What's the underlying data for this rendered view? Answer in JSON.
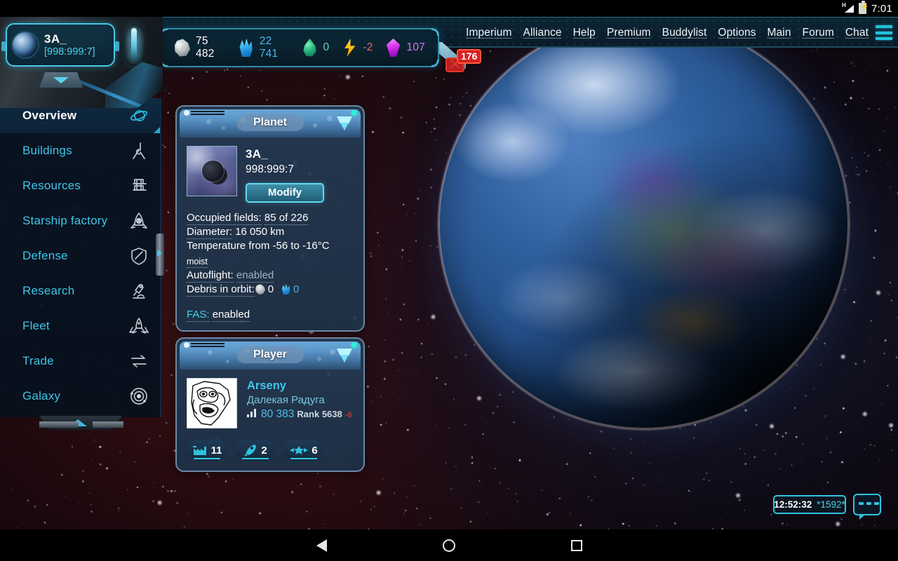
{
  "status_bar": {
    "signal_label": "H",
    "battery_icon": "battery-charging-icon",
    "clock": "7:01"
  },
  "top_nav": {
    "items": [
      {
        "label": "Imperium",
        "name": "imperium"
      },
      {
        "label": "Alliance",
        "name": "alliance"
      },
      {
        "label": "Help",
        "name": "help"
      },
      {
        "label": "Premium",
        "name": "premium"
      },
      {
        "label": "Buddylist",
        "name": "buddylist"
      },
      {
        "label": "Options",
        "name": "options"
      },
      {
        "label": "Main",
        "name": "main"
      },
      {
        "label": "Forum",
        "name": "forum"
      },
      {
        "label": "Chat",
        "name": "chat"
      }
    ],
    "menu_icon": "hamburger-menu-icon"
  },
  "planet_selector": {
    "name": "3A_",
    "coords": "[998:999:7]",
    "dropdown_icon": "chevron-down-icon"
  },
  "resources": [
    {
      "key": "metal",
      "icon": "metal-rock-icon",
      "value": "75 482",
      "color": "#ffffff"
    },
    {
      "key": "crystal",
      "icon": "crystal-icon",
      "value": "22 741",
      "color": "#4cb8ec"
    },
    {
      "key": "deuterium",
      "icon": "deuterium-icon",
      "value": "0",
      "color": "#63d9a6"
    },
    {
      "key": "energy",
      "icon": "energy-bolt-icon",
      "value": "-2",
      "color": "#e86a6a"
    },
    {
      "key": "darkmatter",
      "icon": "dark-matter-icon",
      "value": "107",
      "color": "#d678f0"
    }
  ],
  "mail": {
    "icon": "mail-envelope-icon",
    "unread_count": "176"
  },
  "sidebar": {
    "items": [
      {
        "label": "Overview",
        "icon": "planet-ring-icon",
        "name": "overview",
        "active": true
      },
      {
        "label": "Buildings",
        "icon": "crane-hook-icon",
        "name": "buildings",
        "active": false
      },
      {
        "label": "Resources",
        "icon": "resource-racks-icon",
        "name": "resources",
        "active": false
      },
      {
        "label": "Starship factory",
        "icon": "rocket-gear-icon",
        "name": "starship-factory",
        "active": false
      },
      {
        "label": "Defense",
        "icon": "shield-icon",
        "name": "defense",
        "active": false
      },
      {
        "label": "Research",
        "icon": "microscope-icon",
        "name": "research",
        "active": false
      },
      {
        "label": "Fleet",
        "icon": "fleet-ships-icon",
        "name": "fleet",
        "active": false
      },
      {
        "label": "Trade",
        "icon": "exchange-arrows-icon",
        "name": "trade",
        "active": false
      },
      {
        "label": "Galaxy",
        "icon": "galaxy-orbit-icon",
        "name": "galaxy",
        "active": false
      }
    ],
    "collapse_icon": "chevron-up-icon"
  },
  "planet_panel": {
    "title": "Planet",
    "collapse_icon": "chevron-down-icon",
    "thumbnail_icon": "planet-thumbnail",
    "name": "3A_",
    "coords": "998:999:7",
    "modify_label": "Modify",
    "fields_label": "Occupied fields:",
    "fields_value": "85 of 226",
    "diameter_label": "Diameter:",
    "diameter_value": "16 050 km",
    "temperature_label": "Temperature from",
    "temperature_value": "-56 to -16°C",
    "climate": "moist",
    "autoflight_label": "Autoflight:",
    "autoflight_value": "enabled",
    "debris_label": "Debris in orbit:",
    "debris_metal": "0",
    "debris_crystal": "0",
    "fas_label": "FAS:",
    "fas_value": "enabled"
  },
  "player_panel": {
    "title": "Player",
    "collapse_icon": "chevron-down-icon",
    "avatar_icon": "troll-face-avatar",
    "name": "Arseny",
    "alliance": "Далекая Радуга",
    "points_icon": "bar-chart-icon",
    "points": "80 383",
    "rank_label": "Rank 5638",
    "rank_delta": "-6",
    "stats": [
      {
        "icon": "factory-icon",
        "value": "11",
        "name": "planets-count"
      },
      {
        "icon": "rocket-icon",
        "value": "2",
        "name": "moons-count"
      },
      {
        "icon": "fleet-wing-icon",
        "value": "6",
        "name": "fleet-count"
      }
    ]
  },
  "bottom_widgets": {
    "clock": "12:52:32",
    "ping": "*1592*",
    "chat_icon": "chat-bubble-icon"
  },
  "android_nav": {
    "back_icon": "back-triangle-icon",
    "home_icon": "home-circle-icon",
    "recents_icon": "recents-square-icon"
  },
  "colors": {
    "accent_cyan": "#3fc5e8",
    "panel_border": "#6c89a6",
    "badge_red": "#d62020",
    "nav_text": "#f0f6fa"
  }
}
